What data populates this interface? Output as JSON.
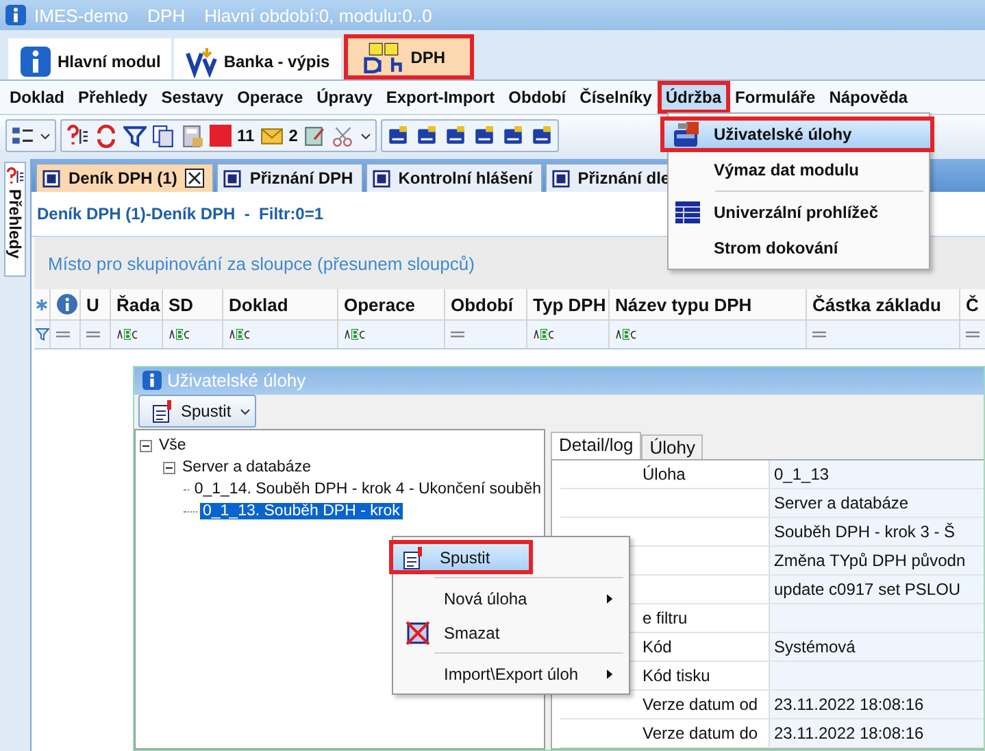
{
  "window": {
    "title": "IMES-demo",
    "module": "DPH",
    "period": "Hlavní období:0, modulu:0..0"
  },
  "module_tabs": [
    {
      "label": "Hlavní modul",
      "selected": false,
      "highlighted": false
    },
    {
      "label": "Banka - výpis",
      "selected": false,
      "highlighted": false
    },
    {
      "label": "DPH",
      "selected": true,
      "highlighted": true
    }
  ],
  "menu": [
    {
      "label": "Doklad",
      "selected": false,
      "highlighted": false
    },
    {
      "label": "Přehledy",
      "selected": false,
      "highlighted": false
    },
    {
      "label": "Sestavy",
      "selected": false,
      "highlighted": false
    },
    {
      "label": "Operace",
      "selected": false,
      "highlighted": false
    },
    {
      "label": "Úpravy",
      "selected": false,
      "highlighted": false
    },
    {
      "label": "Export-Import",
      "selected": false,
      "highlighted": false
    },
    {
      "label": "Období",
      "selected": false,
      "highlighted": false
    },
    {
      "label": "Číselníky",
      "selected": false,
      "highlighted": false
    },
    {
      "label": "Údržba",
      "selected": true,
      "highlighted": true
    },
    {
      "label": "Formuláře",
      "selected": false,
      "highlighted": false
    },
    {
      "label": "Nápověda",
      "selected": false,
      "highlighted": false
    }
  ],
  "toolbar": {
    "counts": [
      "11",
      "2"
    ]
  },
  "side_tab": {
    "label": "Přehledy"
  },
  "doc_tabs": [
    {
      "label": "Deník DPH (1)",
      "selected": true,
      "closable": true
    },
    {
      "label": "Přiznání DPH",
      "selected": false,
      "closable": false
    },
    {
      "label": "Kontrolní hlášení",
      "selected": false,
      "closable": false
    },
    {
      "label": "Přiznání dle",
      "selected": false,
      "closable": false
    }
  ],
  "subtitle": "Deník DPH (1)-Deník DPH  -  Filtr:0=1",
  "group_hint": "Místo pro skupinování za sloupce (přesunem sloupců)",
  "grid": {
    "columns": [
      {
        "kind": "new-row"
      },
      {
        "kind": "info"
      },
      {
        "kind": "text",
        "label": "U"
      },
      {
        "kind": "text",
        "label": "Řada"
      },
      {
        "kind": "text",
        "label": "SD"
      },
      {
        "kind": "text",
        "label": "Doklad"
      },
      {
        "kind": "text",
        "label": "Operace"
      },
      {
        "kind": "text",
        "label": "Období"
      },
      {
        "kind": "text",
        "label": "Typ DPH"
      },
      {
        "kind": "text",
        "label": "Název typu DPH"
      },
      {
        "kind": "text",
        "label": "Částka základu"
      },
      {
        "kind": "text",
        "label": "Č"
      }
    ]
  },
  "dropdown": {
    "items": [
      {
        "kind": "item",
        "label": "Uživatelské úlohy",
        "selected": true,
        "highlighted": true
      },
      {
        "kind": "item",
        "label": "Výmaz dat modulu",
        "selected": false,
        "highlighted": false
      },
      {
        "kind": "separator"
      },
      {
        "kind": "item",
        "label": "Univerzální prohlížeč",
        "selected": false,
        "highlighted": false
      },
      {
        "kind": "item",
        "label": "Strom dokování",
        "selected": false,
        "highlighted": false
      }
    ]
  },
  "dialog": {
    "title": "Uživatelské úlohy",
    "run_button": "Spustit",
    "tree": [
      {
        "label": "Vše",
        "expanded": true,
        "selected": false,
        "children": [
          {
            "label": "Server a databáze",
            "expanded": true,
            "selected": false,
            "children": [
              {
                "label": "0_1_14. Souběh DPH - krok 4 - Ukončení souběh",
                "selected": false
              },
              {
                "label": "0_1_13. Souběh DPH - krok",
                "selected": true
              }
            ]
          }
        ]
      }
    ],
    "tabs": [
      {
        "label": "Detail/log",
        "selected": true
      },
      {
        "label": "Úlohy",
        "selected": false
      }
    ],
    "properties": [
      {
        "name": "Úloha",
        "value": "0_1_13"
      },
      {
        "value": "Server a databáze"
      },
      {
        "value": "Souběh DPH - krok 3 - Š"
      },
      {
        "value": "Změna TYpů DPH původn"
      },
      {
        "value": "update c0917 set PSLOU"
      },
      {
        "name": "e filtru"
      },
      {
        "name": "Kód",
        "value": "Systémová"
      },
      {
        "name": "Kód tisku"
      },
      {
        "name": "Verze datum od",
        "value": "23.11.2022 18:08:16"
      },
      {
        "name": "Verze datum do",
        "value": "23.11.2022 18:08:16"
      }
    ],
    "context_menu": {
      "items": [
        {
          "kind": "item",
          "label": "Spustit",
          "submenu": false,
          "selected": true,
          "highlighted": true
        },
        {
          "kind": "separator"
        },
        {
          "kind": "item",
          "label": "Nová úloha",
          "submenu": true,
          "selected": false,
          "highlighted": false
        },
        {
          "kind": "item",
          "label": "Smazat",
          "submenu": false,
          "selected": false,
          "highlighted": false
        },
        {
          "kind": "separator"
        },
        {
          "kind": "item",
          "label": "Import\\Export úloh",
          "submenu": true,
          "selected": false,
          "highlighted": false
        }
      ]
    }
  }
}
